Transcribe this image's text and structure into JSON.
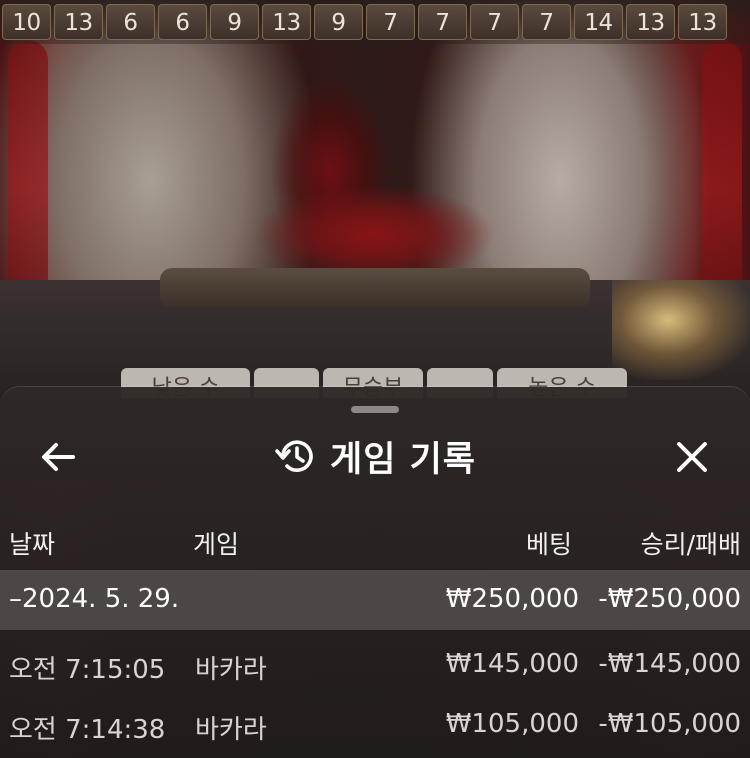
{
  "road": {
    "cells": [
      "10",
      "13",
      "6",
      "6",
      "9",
      "13",
      "9",
      "7",
      "7",
      "7",
      "7",
      "14",
      "13",
      "13"
    ]
  },
  "bet_tabs": [
    "낮은 수",
    "",
    "무승부",
    "",
    "높은 수"
  ],
  "history": {
    "title": "게임 기록",
    "icons": {
      "back": "arrow-left-icon",
      "history": "history-clock-icon",
      "close": "close-icon"
    },
    "columns": {
      "date": "날짜",
      "game": "게임",
      "bet": "베팅",
      "result": "승리/패배"
    },
    "summary": {
      "date": "–2024. 5. 29.",
      "bet": "₩250,000",
      "result": "-₩250,000"
    },
    "rows": [
      {
        "time": "오전 7:15:05",
        "game": "바카라",
        "bet": "₩145,000",
        "result": "-₩145,000"
      },
      {
        "time": "오전 7:14:38",
        "game": "바카라",
        "bet": "₩105,000",
        "result": "-₩105,000"
      }
    ]
  },
  "colors": {
    "panel": "#2e2826",
    "summary_row": "#4c4645",
    "text": "#ffffff"
  }
}
